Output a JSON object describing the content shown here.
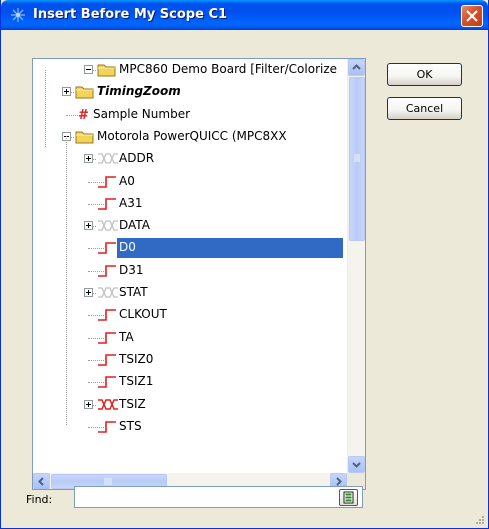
{
  "window": {
    "title": "Insert Before My Scope C1"
  },
  "tree": {
    "items": [
      {
        "label": "MPC860 Demo Board [Filter/Colorize",
        "icon": "folder-icon",
        "expander": "minus"
      },
      {
        "label": "TimingZoom",
        "icon": "folder-icon",
        "expander": "plus",
        "bold_italic": true
      },
      {
        "label": "Sample Number",
        "icon": "hash-icon",
        "expander": "none"
      },
      {
        "label": "Motorola PowerQUICC (MPC8XX",
        "icon": "folder-icon",
        "expander": "minus"
      },
      {
        "label": "ADDR",
        "icon": "bus-icon",
        "expander": "plus"
      },
      {
        "label": "A0",
        "icon": "signal-icon",
        "expander": "none"
      },
      {
        "label": "A31",
        "icon": "signal-icon",
        "expander": "none"
      },
      {
        "label": "DATA",
        "icon": "bus-icon",
        "expander": "plus"
      },
      {
        "label": "D0",
        "icon": "signal-icon",
        "expander": "none",
        "selected": true
      },
      {
        "label": "D31",
        "icon": "signal-icon",
        "expander": "none"
      },
      {
        "label": "STAT",
        "icon": "bus-icon",
        "expander": "plus"
      },
      {
        "label": "CLKOUT",
        "icon": "signal-icon",
        "expander": "none"
      },
      {
        "label": "TA",
        "icon": "signal-icon",
        "expander": "none"
      },
      {
        "label": "TSIZ0",
        "icon": "signal-icon",
        "expander": "none"
      },
      {
        "label": "TSIZ1",
        "icon": "signal-icon",
        "expander": "none"
      },
      {
        "label": "TSIZ",
        "icon": "bus-red-icon",
        "expander": "plus"
      },
      {
        "label": "STS",
        "icon": "signal-icon",
        "expander": "none"
      }
    ]
  },
  "buttons": {
    "ok_label": "OK",
    "cancel_label": "Cancel"
  },
  "find": {
    "label": "Find:",
    "value": ""
  },
  "colors": {
    "titlebar": "#0054e3",
    "selection": "#316ac5",
    "signal_red": "#e02020",
    "folder_yellow": "#f2d35c"
  }
}
